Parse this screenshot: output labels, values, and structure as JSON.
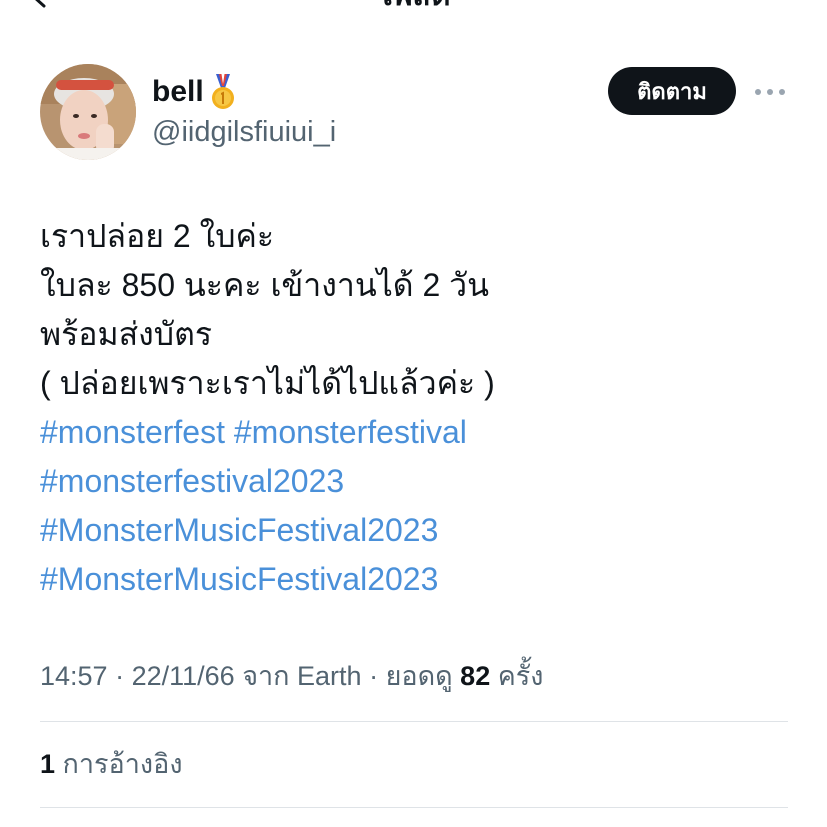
{
  "header": {
    "title": "โพสต์"
  },
  "author": {
    "display_name": "bell",
    "handle": "@iidgilsfiuiui_i",
    "badge_icon": "gold-medal-icon"
  },
  "actions": {
    "follow_label": "ติดตาม",
    "more_icon": "more-horizontal-icon"
  },
  "tweet": {
    "lines": [
      "เราปล่อย 2 ใบค่ะ",
      "ใบละ 850 นะคะ เข้างานได้ 2 วัน",
      "พร้อมส่งบัตร",
      "( ปล่อยเพราะเราไม่ได้ไปแล้วค่ะ )"
    ],
    "hashtag_lines": [
      "#monsterfest #monsterfestival",
      "#monsterfestival2023",
      "#MonsterMusicFestival2023",
      "#MonsterMusicFestival2023"
    ]
  },
  "meta": {
    "time": "14:57",
    "separator": " · ",
    "date": "22/11/66",
    "source": " จาก Earth",
    "views_prefix": "ยอดดู ",
    "views_count": "82",
    "views_suffix": " ครั้ง"
  },
  "quotes": {
    "count": "1",
    "label": " การอ้างอิง"
  },
  "colors": {
    "hashtag": "#4a90d9",
    "follow_bg": "#0f1419",
    "secondary_text": "#536471"
  }
}
